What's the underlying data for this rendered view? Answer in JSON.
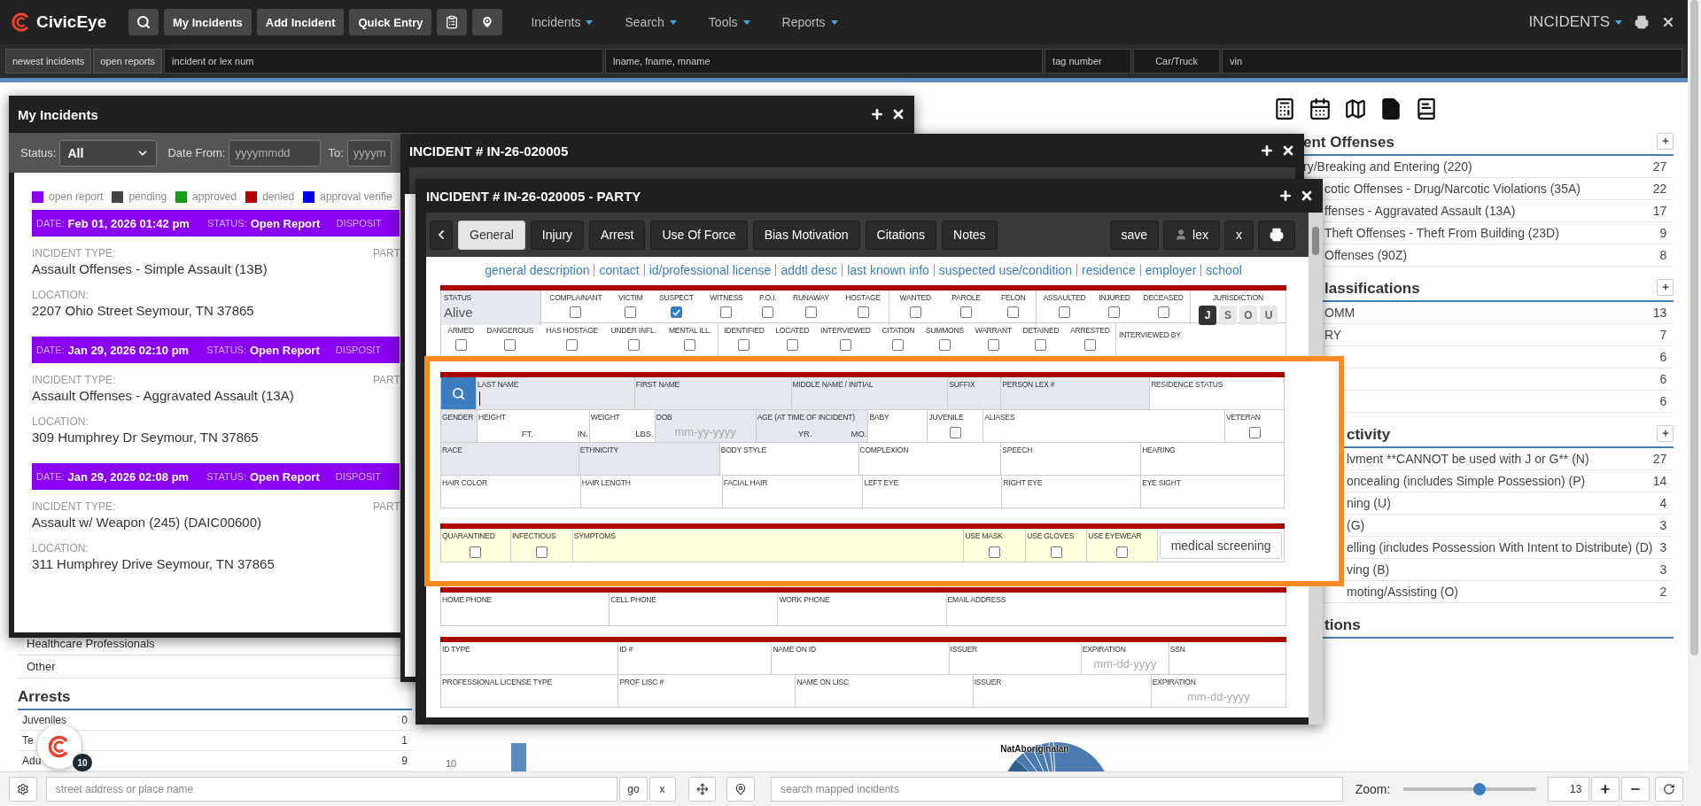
{
  "navbar": {
    "brand": "CivicEye",
    "buttons": [
      "My Incidents",
      "Add Incident",
      "Quick Entry"
    ],
    "menus": [
      "Incidents",
      "Search",
      "Tools",
      "Reports"
    ],
    "module": "INCIDENTS"
  },
  "quick_search": {
    "buttons": [
      "newest incidents",
      "open reports"
    ],
    "fields": [
      {
        "kind": "input",
        "placeholder": "incident or lex num"
      },
      {
        "kind": "input",
        "placeholder": "lname, fname, mname"
      },
      {
        "kind": "input",
        "placeholder": "tag number"
      },
      {
        "kind": "select",
        "placeholder": "Car/Truck"
      },
      {
        "kind": "input",
        "placeholder": "vin"
      }
    ]
  },
  "dashboard": {
    "left_list": [
      "Healthcare Professionals",
      "Other"
    ],
    "arrests": {
      "title": "Arrests",
      "rows": [
        {
          "label": "Juveniles",
          "count": "0"
        },
        {
          "label": "Te",
          "count": "1"
        },
        {
          "label": "Adu",
          "count": "9"
        }
      ]
    },
    "bar_tick": "10",
    "pie_label": "NatAboriginalan",
    "sections": [
      {
        "title": "ent Offenses",
        "rows": [
          {
            "label": "ry/Breaking and Entering (220)",
            "count": "27"
          },
          {
            "label": "cotic Offenses - Drug/Narcotic Violations (35A)",
            "count": "22"
          },
          {
            "label": "ffenses - Aggravated Assault (13A)",
            "count": "17"
          },
          {
            "label": "Theft Offenses - Theft From Building (23D)",
            "count": "9"
          },
          {
            "label": "Offenses (90Z)",
            "count": "8"
          }
        ]
      },
      {
        "title": "lassifications",
        "rows": [
          {
            "label": "OMM",
            "count": "13"
          },
          {
            "label": "RY",
            "count": "7"
          },
          {
            "count": "6"
          },
          {
            "count": "6"
          },
          {
            "count": "6"
          }
        ]
      },
      {
        "title": "ctivity",
        "rows": [
          {
            "label": "lvment **CANNOT be used with J or G** (N)",
            "count": "27"
          },
          {
            "label": "oncealing (includes Simple Possession) (P)",
            "count": "14"
          },
          {
            "label": "ning (U)",
            "count": "4"
          },
          {
            "label": "(G)",
            "count": "3"
          },
          {
            "label": "elling (includes Possession With Intent to Distribute) (D)",
            "count": "3"
          },
          {
            "label": "ving (B)",
            "count": "3"
          },
          {
            "label": "moting/Assisting (O)",
            "count": "2"
          }
        ]
      },
      {
        "title": "tions"
      }
    ]
  },
  "my_incidents": {
    "title": "My Incidents",
    "status_label": "Status:",
    "status_value": "All",
    "date_from_label": "Date From:",
    "date_from_placeholder": "yyyymmdd",
    "to_label": "To:",
    "to_placeholder": "yyyym",
    "legend": [
      {
        "label": "open report",
        "color": "#8a00f0"
      },
      {
        "label": "pending",
        "color": "#444444"
      },
      {
        "label": "approved",
        "color": "#1a9a1a"
      },
      {
        "label": "denied",
        "color": "#b30000"
      },
      {
        "label": "approval verifie",
        "color": "#0000ee"
      }
    ],
    "incidents": [
      {
        "date_label": "DATE:",
        "date": "Feb 01, 2026 01:42 pm",
        "status_label": "STATUS:",
        "status": "Open Report",
        "disposition_label": "DISPOSIT",
        "color": "#8a00f0",
        "type_label": "INCIDENT TYPE:",
        "type": "Assault Offenses - Simple Assault (13B)",
        "location_label": "LOCATION:",
        "location": "2207 Ohio Street Seymour, TN 37865",
        "party_label": "PART"
      },
      {
        "date_label": "DATE:",
        "date": "Jan 29, 2026 02:10 pm",
        "status_label": "STATUS:",
        "status": "Open Report",
        "disposition_label": "DISPOSIT",
        "color": "#8a00f0",
        "type_label": "INCIDENT TYPE:",
        "type": "Assault Offenses - Aggravated Assault (13A)",
        "location_label": "LOCATION:",
        "location": "309 Humphrey Dr Seymour, TN 37865",
        "party_label": "PART"
      },
      {
        "date_label": "DATE:",
        "date": "Jan 29, 2026 02:08 pm",
        "status_label": "STATUS:",
        "status": "Open Report",
        "disposition_label": "DISPOSIT",
        "color": "#8a00f0",
        "type_label": "INCIDENT TYPE:",
        "type": "Assault w/ Weapon (245) (DAIC00600)",
        "location_label": "LOCATION:",
        "location": "311 Humphrey Drive Seymour, TN 37865",
        "party_label": "PART"
      }
    ]
  },
  "incident_window": {
    "title": "INCIDENT # IN-26-020005"
  },
  "party_window": {
    "title": "INCIDENT # IN-26-020005 - PARTY",
    "tabs": [
      {
        "label": "General",
        "selected": true
      },
      {
        "label": "Injury",
        "selected": false
      },
      {
        "label": "Arrest",
        "selected": false
      },
      {
        "label": "Use Of Force",
        "selected": false
      },
      {
        "label": "Bias Motivation",
        "selected": false
      },
      {
        "label": "Citations",
        "selected": false
      },
      {
        "label": "Notes",
        "selected": false
      }
    ],
    "actions": [
      "save",
      "lex",
      "x"
    ],
    "links": [
      "general description",
      "contact",
      "id/professional license",
      "addtl desc",
      "last known info",
      "suspected use/condition",
      "residence",
      "employer",
      "school"
    ],
    "status": {
      "label": "STATUS",
      "value": "Alive"
    },
    "flag_rows": [
      [
        [
          {
            "label": "COMPLAINANT",
            "checked": false
          },
          {
            "label": "VICTIM",
            "checked": false
          },
          {
            "label": "SUSPECT",
            "checked": true
          },
          {
            "label": "WITNESS",
            "checked": false
          },
          {
            "label": "P.O.I.",
            "checked": false
          },
          {
            "label": "RUNAWAY",
            "checked": false
          },
          {
            "label": "HOSTAGE",
            "checked": false
          }
        ],
        [
          {
            "label": "WANTED",
            "checked": false
          },
          {
            "label": "PAROLE",
            "checked": false
          },
          {
            "label": "FELON",
            "checked": false
          }
        ],
        [
          {
            "label": "ASSAULTED",
            "checked": false
          },
          {
            "label": "INJURED",
            "checked": false
          },
          {
            "label": "DECEASED",
            "checked": false
          }
        ]
      ],
      [
        [
          {
            "label": "ARMED",
            "checked": false
          },
          {
            "label": "DANGEROUS",
            "checked": false
          },
          {
            "label": "HAS HOSTAGE",
            "checked": false
          },
          {
            "label": "UNDER INFL.",
            "checked": false
          },
          {
            "label": "MENTAL ILL.",
            "checked": false
          }
        ],
        [
          {
            "label": "IDENTIFIED",
            "checked": false
          },
          {
            "label": "LOCATED",
            "checked": false
          },
          {
            "label": "INTERVIEWED",
            "checked": false
          },
          {
            "label": "CITATION",
            "checked": false
          },
          {
            "label": "SUMMONS",
            "checked": false
          },
          {
            "label": "WARRANT",
            "checked": false
          },
          {
            "label": "DETAINED",
            "checked": false
          },
          {
            "label": "ARRESTED",
            "checked": false
          }
        ]
      ]
    ],
    "jurisdiction": {
      "label": "JURISDICTION",
      "options": [
        {
          "label": "J",
          "selected": true
        },
        {
          "label": "S",
          "selected": false
        },
        {
          "label": "O",
          "selected": false
        },
        {
          "label": "U",
          "selected": false
        }
      ]
    },
    "interviewed_by": "INTERVIEWED BY",
    "identity_rows": [
      [
        {
          "label": "LAST NAME",
          "kind": "caret",
          "shaded": true
        },
        {
          "label": "FIRST NAME",
          "kind": "input",
          "shaded": true
        },
        {
          "label": "MIDDLE NAME / INITIAL",
          "kind": "input",
          "shaded": true
        },
        {
          "label": "SUFFIX",
          "kind": "input",
          "shaded": true
        },
        {
          "label": "PERSON LEX #",
          "kind": "input",
          "shaded": true
        },
        {
          "label": "RESIDENCE STATUS",
          "kind": "input",
          "shaded": false
        }
      ],
      [
        {
          "label": "GENDER",
          "kind": "input",
          "shaded": true
        },
        {
          "label": "HEIGHT",
          "kind": "input",
          "shaded": false,
          "units": [
            "FT.",
            "IN."
          ]
        },
        {
          "label": "WEIGHT",
          "kind": "input",
          "shaded": false,
          "units": [
            "LBS."
          ]
        },
        {
          "label": "DOB",
          "kind": "input",
          "shaded": true,
          "placeholder": "mm-yy-yyyy"
        },
        {
          "label": "AGE (AT TIME OF INCIDENT)",
          "kind": "input",
          "shaded": true,
          "units": [
            "YR.",
            "MO."
          ]
        },
        {
          "label": "BABY",
          "kind": "input",
          "shaded": false
        },
        {
          "label": "JUVENILE",
          "kind": "checkbox",
          "shaded": false,
          "checked": false
        },
        {
          "label": "ALIASES",
          "kind": "input",
          "shaded": false
        },
        {
          "label": "VETERAN",
          "kind": "checkbox",
          "shaded": false,
          "checked": false
        }
      ],
      [
        {
          "label": "RACE",
          "kind": "input",
          "shaded": true
        },
        {
          "label": "ETHNICITY",
          "kind": "input",
          "shaded": true
        },
        {
          "label": "BODY STYLE",
          "kind": "input",
          "shaded": false
        },
        {
          "label": "COMPLEXION",
          "kind": "input",
          "shaded": false
        },
        {
          "label": "SPEECH",
          "kind": "input",
          "shaded": false
        },
        {
          "label": "HEARING",
          "kind": "input",
          "shaded": false
        }
      ],
      [
        {
          "label": "HAIR COLOR",
          "kind": "input",
          "shaded": false
        },
        {
          "label": "HAIR LENGTH",
          "kind": "input",
          "shaded": false
        },
        {
          "label": "FACIAL HAIR",
          "kind": "input",
          "shaded": false
        },
        {
          "label": "LEFT EYE",
          "kind": "input",
          "shaded": false
        },
        {
          "label": "RIGHT EYE",
          "kind": "input",
          "shaded": false
        },
        {
          "label": "EYE SIGHT",
          "kind": "input",
          "shaded": false
        }
      ]
    ],
    "medical": {
      "cells": [
        {
          "label": "QUARANTINED",
          "kind": "checkbox",
          "checked": false
        },
        {
          "label": "INFECTIOUS",
          "kind": "checkbox",
          "checked": false
        },
        {
          "label": "SYMPTOMS",
          "kind": "input"
        },
        {
          "label": "USE MASK",
          "kind": "checkbox",
          "checked": false
        },
        {
          "label": "USE GLOVES",
          "kind": "checkbox",
          "checked": false
        },
        {
          "label": "USE EYEWEAR",
          "kind": "checkbox",
          "checked": false
        }
      ],
      "button": "medical screening"
    },
    "contact": [
      "HOME PHONE",
      "CELL PHONE",
      "WORK PHONE",
      "EMAIL ADDRESS"
    ],
    "id_rows": [
      [
        {
          "label": "ID TYPE"
        },
        {
          "label": "ID #"
        },
        {
          "label": "NAME ON ID"
        },
        {
          "label": "ISSUER"
        },
        {
          "label": "EXPIRATION",
          "placeholder": "mm-dd-yyyy"
        },
        {
          "label": "SSN"
        }
      ],
      [
        {
          "label": "PROFESSIONAL LICENSE TYPE"
        },
        {
          "label": "PROF LISC #"
        },
        {
          "label": "NAME ON LISC"
        },
        {
          "label": "ISSUER"
        },
        {
          "label": "EXPIRATION",
          "placeholder": "mm-dd-yyyy"
        }
      ]
    ]
  },
  "launcher": {
    "count": "10"
  },
  "map_bar": {
    "address_placeholder": "street address or place name",
    "go": "go",
    "clear": "x",
    "search_placeholder": "search mapped incidents",
    "zoom_label": "Zoom:",
    "zoom": {
      "level": 0.57
    },
    "zoom_value": "13"
  }
}
